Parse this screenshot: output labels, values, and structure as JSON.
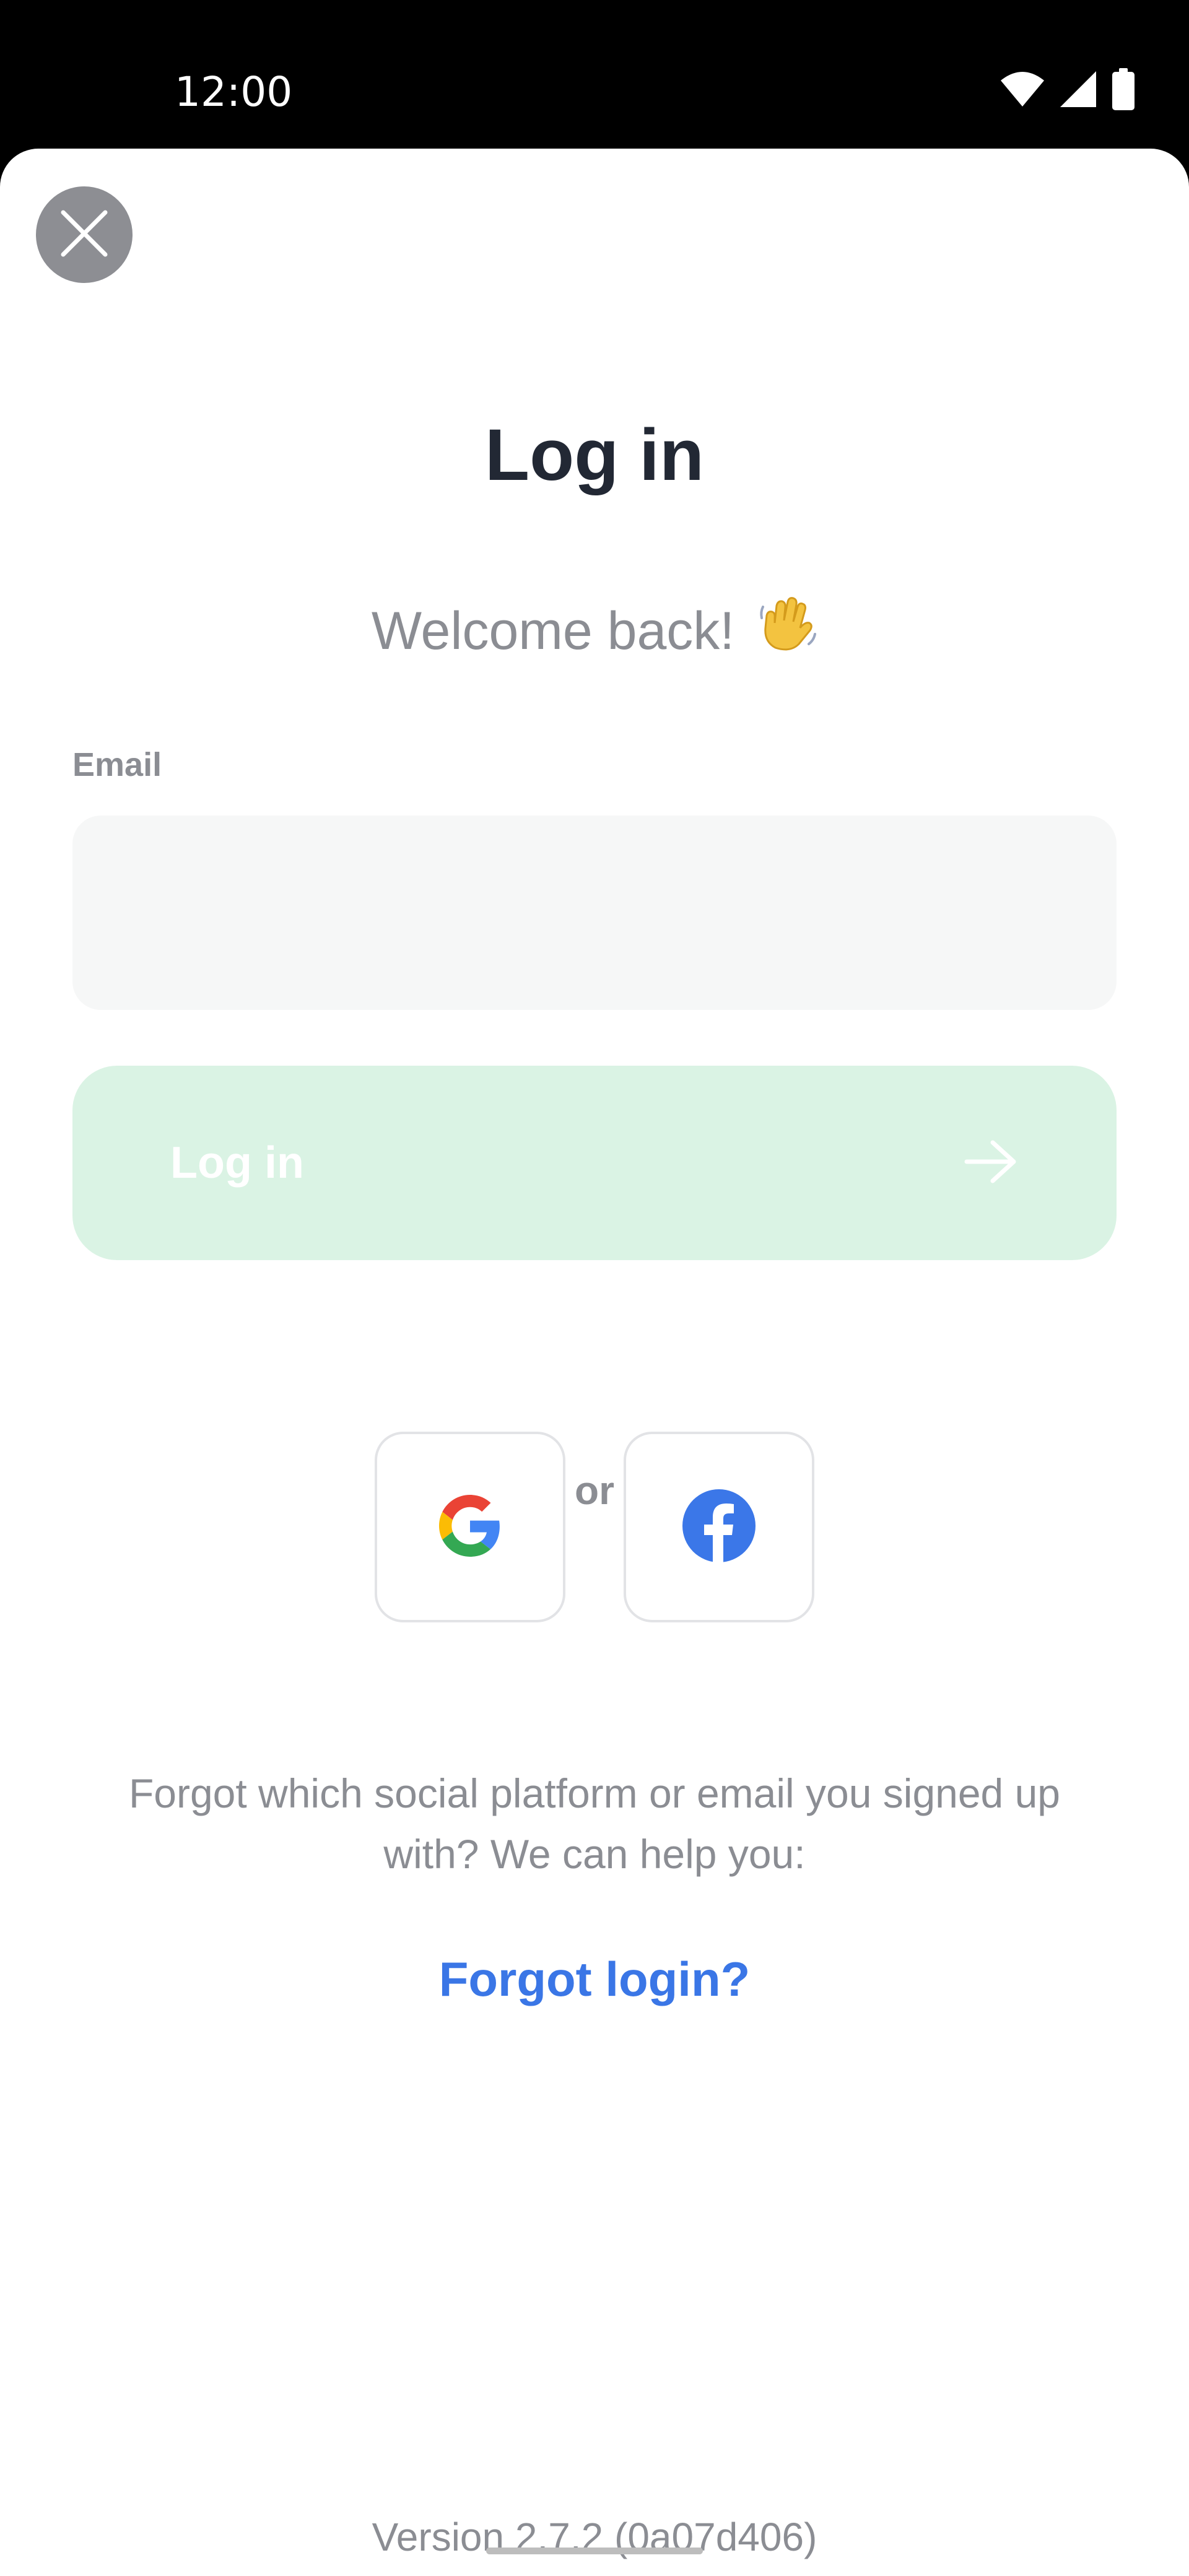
{
  "status_bar": {
    "time": "12:00",
    "icons": [
      "wifi-icon",
      "cellular-signal-icon",
      "battery-icon"
    ]
  },
  "header": {
    "close_icon": "close-icon",
    "title": "Log in",
    "subtitle": "Welcome back!",
    "subtitle_emoji": "waving-hand-icon"
  },
  "form": {
    "email_label": "Email",
    "email_value": "",
    "email_placeholder": "",
    "submit_label": "Log in",
    "submit_icon": "arrow-right-icon"
  },
  "divider_text": "or",
  "social": [
    {
      "name": "Google",
      "icon": "google-icon"
    },
    {
      "name": "Facebook",
      "icon": "facebook-icon"
    }
  ],
  "help": {
    "text": "Forgot which social platform or email you signed up with? We can help you:",
    "link": "Forgot login?"
  },
  "version": "Version 2.7.2 (0a07d406)",
  "colors": {
    "title": "#222834",
    "muted_text": "#8b8d93",
    "button_disabled_bg": "#daf3e4",
    "link": "#3a76e6",
    "input_bg": "#f6f7f7",
    "facebook_blue": "#1877f2"
  }
}
